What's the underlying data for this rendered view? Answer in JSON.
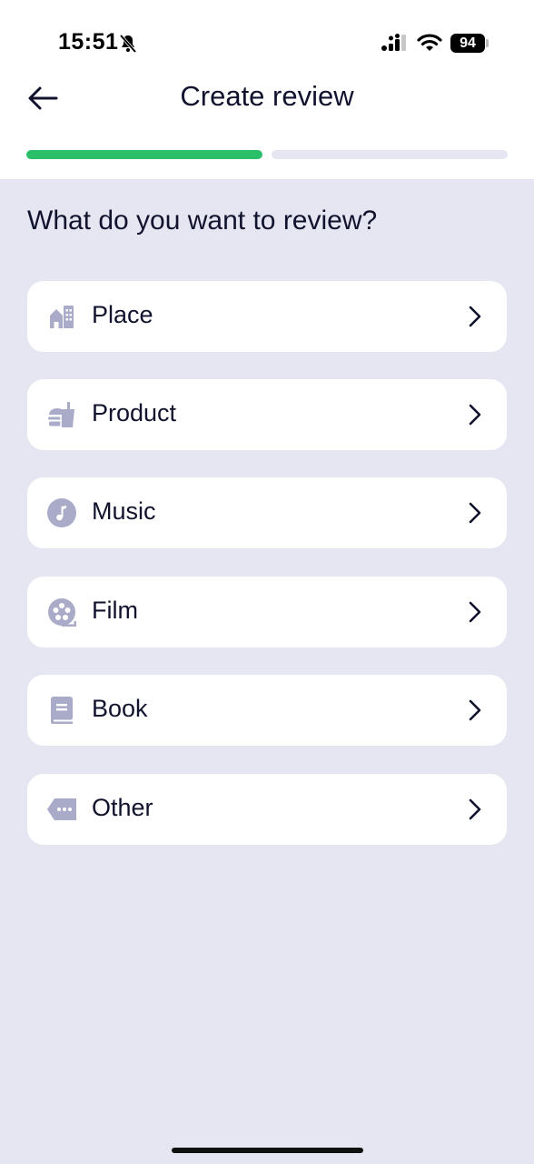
{
  "status_bar": {
    "time": "15:51",
    "battery": "94"
  },
  "nav": {
    "title": "Create review"
  },
  "progress": {
    "step": 1,
    "total_steps": 2
  },
  "question": "What do you want to review?",
  "options": [
    {
      "label": "Place",
      "icon": "building-icon"
    },
    {
      "label": "Product",
      "icon": "food-icon"
    },
    {
      "label": "Music",
      "icon": "music-note-icon"
    },
    {
      "label": "Film",
      "icon": "film-reel-icon"
    },
    {
      "label": "Book",
      "icon": "book-icon"
    },
    {
      "label": "Other",
      "icon": "tag-icon"
    }
  ],
  "colors": {
    "accent": "#2cbf69",
    "background": "#e6e6f2",
    "card": "#ffffff",
    "text": "#11132e",
    "icon": "#a9abc9"
  }
}
